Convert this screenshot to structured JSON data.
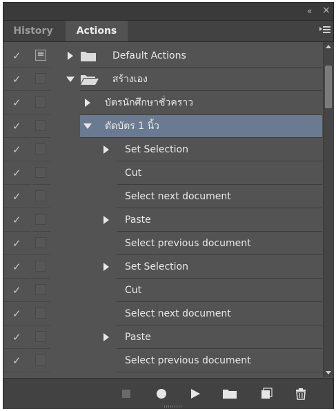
{
  "window": {
    "collapse_glyph": "«",
    "close_glyph": "×"
  },
  "tabs": [
    {
      "label": "History",
      "active": false
    },
    {
      "label": "Actions",
      "active": true
    }
  ],
  "rows": [
    {
      "label": "Default Actions",
      "checked": true,
      "dialog_on": true,
      "expand": "collapsed",
      "type": "set"
    },
    {
      "label": "สร้างเอง",
      "checked": true,
      "dialog_on": false,
      "expand": "expanded",
      "type": "set"
    },
    {
      "label": "บัตรนักศึกษาชั่วคราว",
      "checked": true,
      "dialog_on": false,
      "expand": "collapsed",
      "type": "action"
    },
    {
      "label": "ตัดบัตร 1 นิ้ว",
      "checked": true,
      "dialog_on": false,
      "expand": "expanded",
      "type": "action",
      "selected": true
    },
    {
      "label": "Set Selection",
      "checked": true,
      "dialog_on": false,
      "expand": "collapsed",
      "type": "step"
    },
    {
      "label": "Cut",
      "checked": true,
      "dialog_on": false,
      "expand": "none",
      "type": "step"
    },
    {
      "label": "Select next document",
      "checked": true,
      "dialog_on": false,
      "expand": "none",
      "type": "step"
    },
    {
      "label": "Paste",
      "checked": true,
      "dialog_on": false,
      "expand": "collapsed",
      "type": "step"
    },
    {
      "label": "Select previous document",
      "checked": true,
      "dialog_on": false,
      "expand": "none",
      "type": "step"
    },
    {
      "label": "Set Selection",
      "checked": true,
      "dialog_on": false,
      "expand": "collapsed",
      "type": "step"
    },
    {
      "label": "Cut",
      "checked": true,
      "dialog_on": false,
      "expand": "none",
      "type": "step"
    },
    {
      "label": "Select next document",
      "checked": true,
      "dialog_on": false,
      "expand": "none",
      "type": "step"
    },
    {
      "label": "Paste",
      "checked": true,
      "dialog_on": false,
      "expand": "collapsed",
      "type": "step"
    },
    {
      "label": "Select previous document",
      "checked": true,
      "dialog_on": false,
      "expand": "none",
      "type": "step"
    },
    {
      "label": "",
      "checked": true,
      "dialog_on": false,
      "expand": "none",
      "type": "step"
    }
  ],
  "toolbar": [
    "stop-icon",
    "record-icon",
    "play-icon",
    "new-set-icon",
    "new-action-icon",
    "delete-icon"
  ],
  "colors": {
    "panel_bg": "#535353",
    "selection": "#6a7a90",
    "text": "#e8e8e8"
  }
}
